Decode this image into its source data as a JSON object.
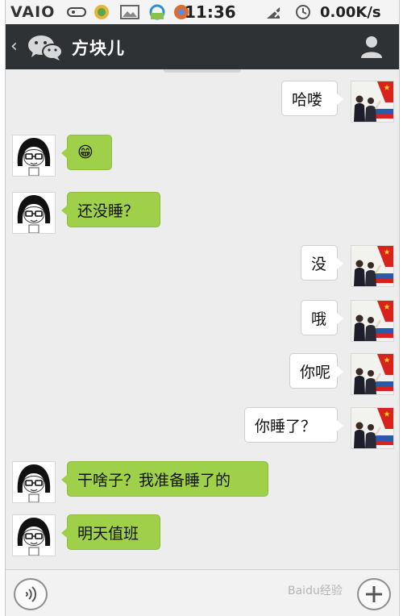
{
  "status_bar": {
    "brand": "VAIO",
    "time": "11:36",
    "net_speed": "0.00K/s"
  },
  "header": {
    "back_icon": "chevron-left-icon",
    "logo_icon": "wechat-logo-icon",
    "title": "方块儿",
    "profile_icon": "person-icon"
  },
  "messages": [
    {
      "side": "out",
      "text": "哈喽"
    },
    {
      "side": "in",
      "text": "😁"
    },
    {
      "side": "in",
      "text": "还没睡？"
    },
    {
      "side": "out",
      "text": "没"
    },
    {
      "side": "out",
      "text": "哦"
    },
    {
      "side": "out",
      "text": "你呢"
    },
    {
      "side": "out",
      "text": "你睡了？"
    },
    {
      "side": "in",
      "text": "干啥子？我准备睡了的"
    },
    {
      "side": "in",
      "text": "明天值班"
    }
  ],
  "input_bar": {
    "voice_icon": "voice-icon",
    "plus_icon": "plus-icon"
  },
  "watermark": "Baidu经验",
  "colors": {
    "header_bg": "#2e3235",
    "incoming_bubble": "#9ed04a",
    "outgoing_bubble": "#ffffff",
    "chat_bg": "#ededed"
  }
}
